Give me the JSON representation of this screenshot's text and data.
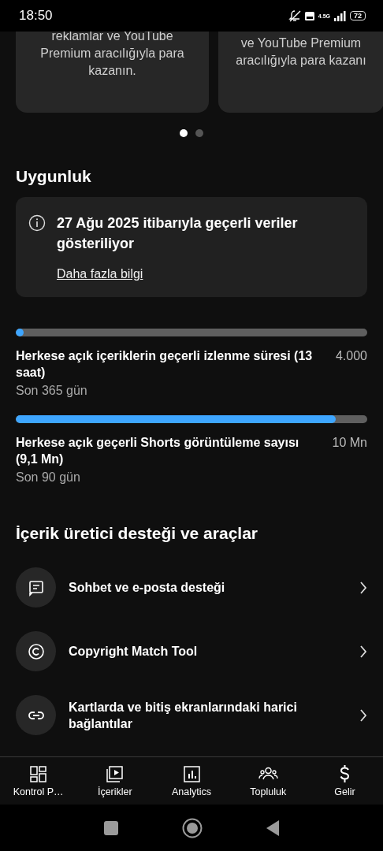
{
  "status_bar": {
    "time": "18:50",
    "network": "4.5G",
    "battery": "72"
  },
  "carousel": {
    "cards": [
      {
        "text": "reklamlar ve YouTube Premium aracılığıyla para kazanın."
      },
      {
        "text": "ve YouTube Premium aracılığıyla para kazanı"
      }
    ],
    "dots": [
      {
        "selected": true
      },
      {
        "selected": false
      }
    ]
  },
  "eligibility": {
    "title": "Uygunluk",
    "notice": "27 Ağu 2025 itibarıyla geçerli veriler gösteriliyor",
    "link": "Daha fazla bilgi",
    "metrics": [
      {
        "label": "Herkese açık içeriklerin geçerli izlenme süresi (13 saat)",
        "target": "4.000",
        "period": "Son 365 gün",
        "level": 0.01
      },
      {
        "label": "Herkese açık geçerli Shorts görüntüleme sayısı (9,1 Mn)",
        "target": "10 Mn",
        "period": "Son 90 gün",
        "level": 0.91
      }
    ]
  },
  "support": {
    "title": "İçerik üretici desteği ve araçlar",
    "items": [
      {
        "kind": "chat",
        "label": "Sohbet ve e-posta desteği"
      },
      {
        "kind": "copyright",
        "label": "Copyright Match Tool"
      },
      {
        "kind": "link",
        "label": "Kartlarda ve bitiş ekranlarındaki harici bağlantılar"
      }
    ]
  },
  "bottom_nav": [
    {
      "kind": "dashboard",
      "label": "Kontrol P…"
    },
    {
      "kind": "content",
      "label": "İçerikler"
    },
    {
      "kind": "analytics",
      "label": "Analytics"
    },
    {
      "kind": "community",
      "label": "Topluluk"
    },
    {
      "kind": "earn",
      "label": "Gelir"
    }
  ]
}
